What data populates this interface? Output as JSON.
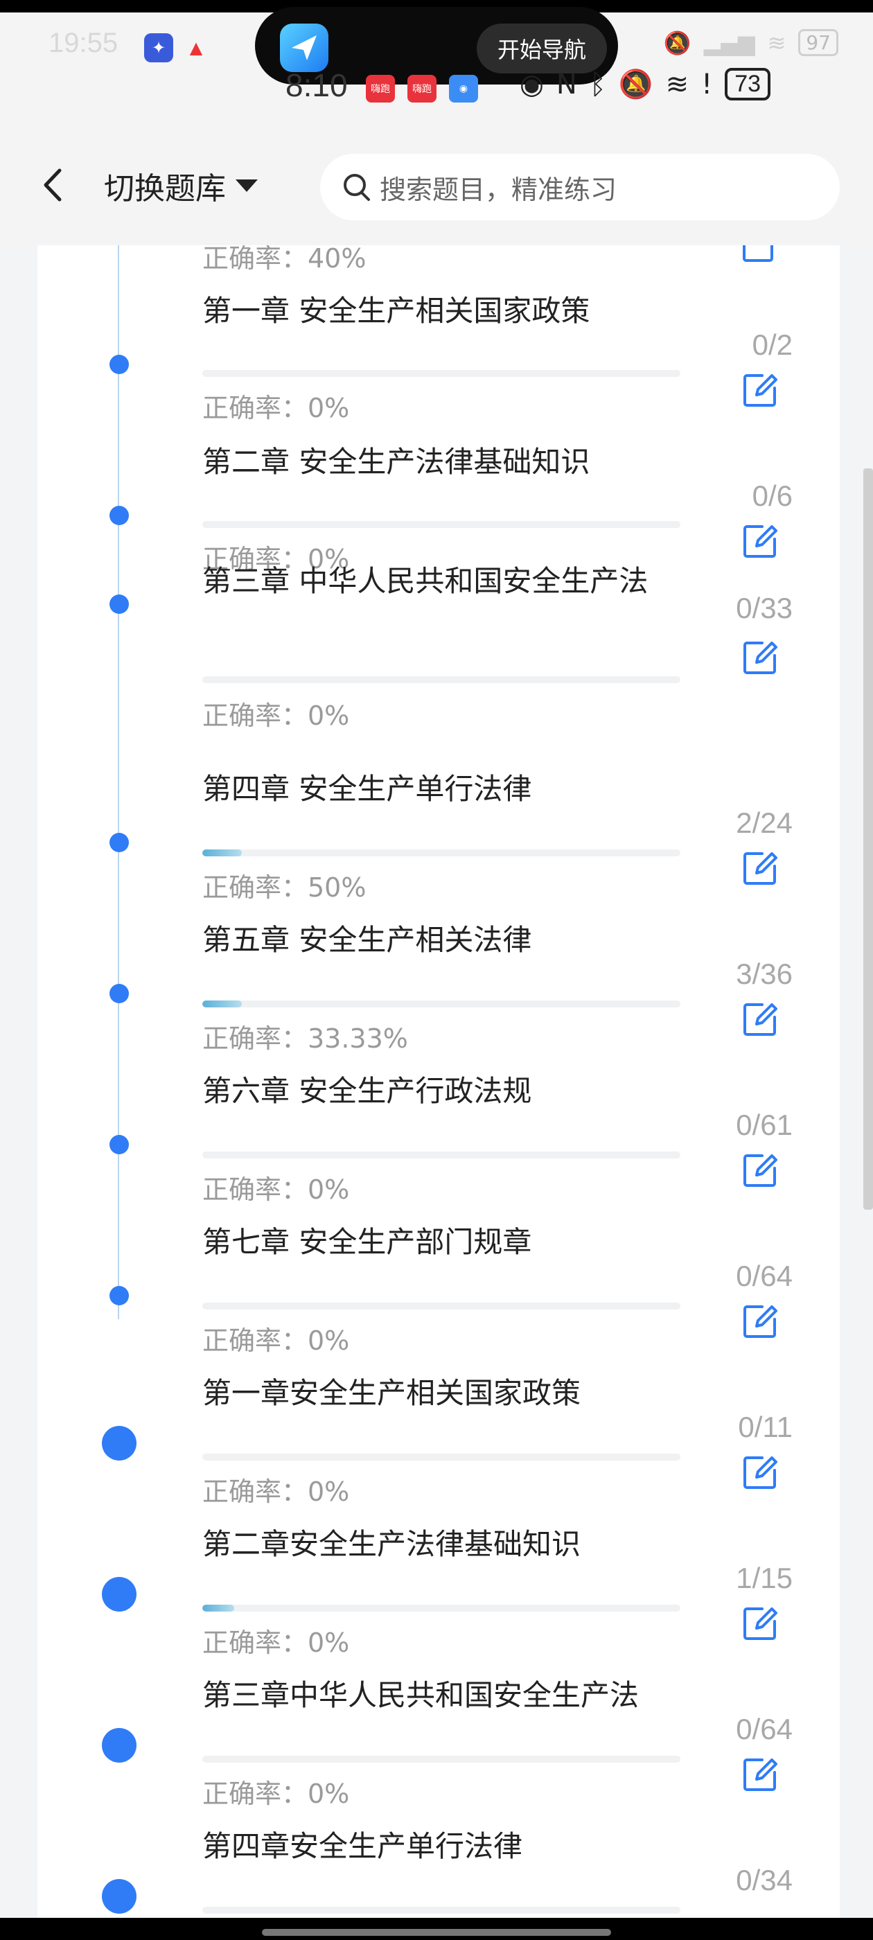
{
  "outer_status": {
    "time": "19:55",
    "battery": "97"
  },
  "nav_pill": {
    "button_label": "开始导航"
  },
  "inner_status": {
    "time": "8:10",
    "badge_text": "嗨跑",
    "battery": "73"
  },
  "header": {
    "switch_label": "切换题库",
    "search_placeholder": "搜索题目，精准练习"
  },
  "partial_top_item": {
    "accuracy": "正确率：40%"
  },
  "items": [
    {
      "title": "第一章 安全生产相关国家政策",
      "count": "0/2",
      "accuracy": "正确率：0%",
      "progress": 0
    },
    {
      "title": "第二章 安全生产法律基础知识",
      "count": "0/6",
      "accuracy": "正确率：0%",
      "progress": 0
    },
    {
      "title": "第三章 中华人民共和国安全生产法",
      "count": "0/33",
      "accuracy": "正确率：0%",
      "progress": 0
    },
    {
      "title": "第四章 安全生产单行法律",
      "count": "2/24",
      "accuracy": "正确率：50%",
      "progress": 0.083
    },
    {
      "title": "第五章 安全生产相关法律",
      "count": "3/36",
      "accuracy": "正确率：33.33%",
      "progress": 0.083
    },
    {
      "title": "第六章 安全生产行政法规",
      "count": "0/61",
      "accuracy": "正确率：0%",
      "progress": 0
    },
    {
      "title": "第七章 安全生产部门规章",
      "count": "0/64",
      "accuracy": "正确率：0%",
      "progress": 0
    },
    {
      "title": "第一章安全生产相关国家政策",
      "count": "0/11",
      "accuracy": "正确率：0%",
      "progress": 0
    },
    {
      "title": "第二章安全生产法律基础知识",
      "count": "1/15",
      "accuracy": "正确率：0%",
      "progress": 0.067
    },
    {
      "title": "第三章中华人民共和国安全生产法",
      "count": "0/64",
      "accuracy": "正确率：0%",
      "progress": 0
    },
    {
      "title": "第四章安全生产单行法律",
      "count": "0/34",
      "accuracy": "",
      "progress": 0
    }
  ],
  "colors": {
    "accent": "#2f7cf6",
    "progress_fill": "#5ab0d8",
    "muted_text": "#9a9a9a"
  }
}
